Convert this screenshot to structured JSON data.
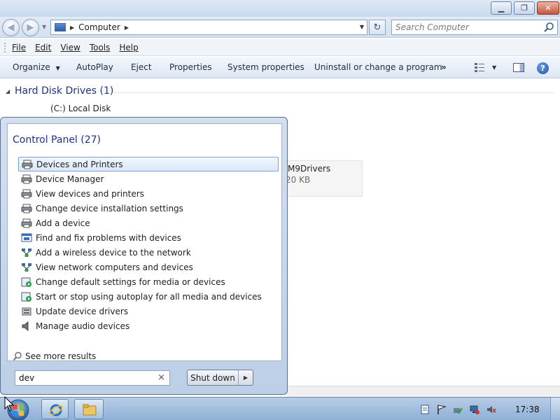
{
  "window": {
    "address": {
      "location": "Computer"
    },
    "search": {
      "placeholder": "Search Computer"
    },
    "menu": [
      "File",
      "Edit",
      "View",
      "Tools",
      "Help"
    ],
    "commands": {
      "organize": "Organize",
      "autoplay": "AutoPlay",
      "eject": "Eject",
      "properties": "Properties",
      "system_properties": "System properties",
      "uninstall": "Uninstall or change a program",
      "more": "»"
    },
    "content": {
      "group_header": "Hard Disk Drives (1)",
      "disk_label": "(C:) Local Disk",
      "tile_name": "M9Drivers",
      "tile_size": "20 KB"
    }
  },
  "start_menu": {
    "group_header": "Control Panel (27)",
    "items": [
      {
        "label": "Devices and Printers",
        "icon": "printer-icon",
        "selected": true
      },
      {
        "label": "Device Manager",
        "icon": "printer-icon"
      },
      {
        "label": "View devices and printers",
        "icon": "printer-icon"
      },
      {
        "label": "Change device installation settings",
        "icon": "printer-icon"
      },
      {
        "label": "Add a device",
        "icon": "printer-icon"
      },
      {
        "label": "Find and fix problems with devices",
        "icon": "troubleshoot-icon"
      },
      {
        "label": "Add a wireless device to the network",
        "icon": "network-icon"
      },
      {
        "label": "View network computers and devices",
        "icon": "network-icon"
      },
      {
        "label": "Change default settings for media or devices",
        "icon": "autoplay-icon"
      },
      {
        "label": "Start or stop using autoplay for all media and devices",
        "icon": "autoplay-icon"
      },
      {
        "label": "Update device drivers",
        "icon": "driver-icon"
      },
      {
        "label": "Manage audio devices",
        "icon": "speaker-icon"
      }
    ],
    "see_more": "See more results",
    "search_value": "dev",
    "shutdown_label": "Shut down"
  },
  "taskbar": {
    "clock": "17:38"
  },
  "colors": {
    "header_blue": "#1e3287",
    "selection_border": "#7da2ce"
  }
}
